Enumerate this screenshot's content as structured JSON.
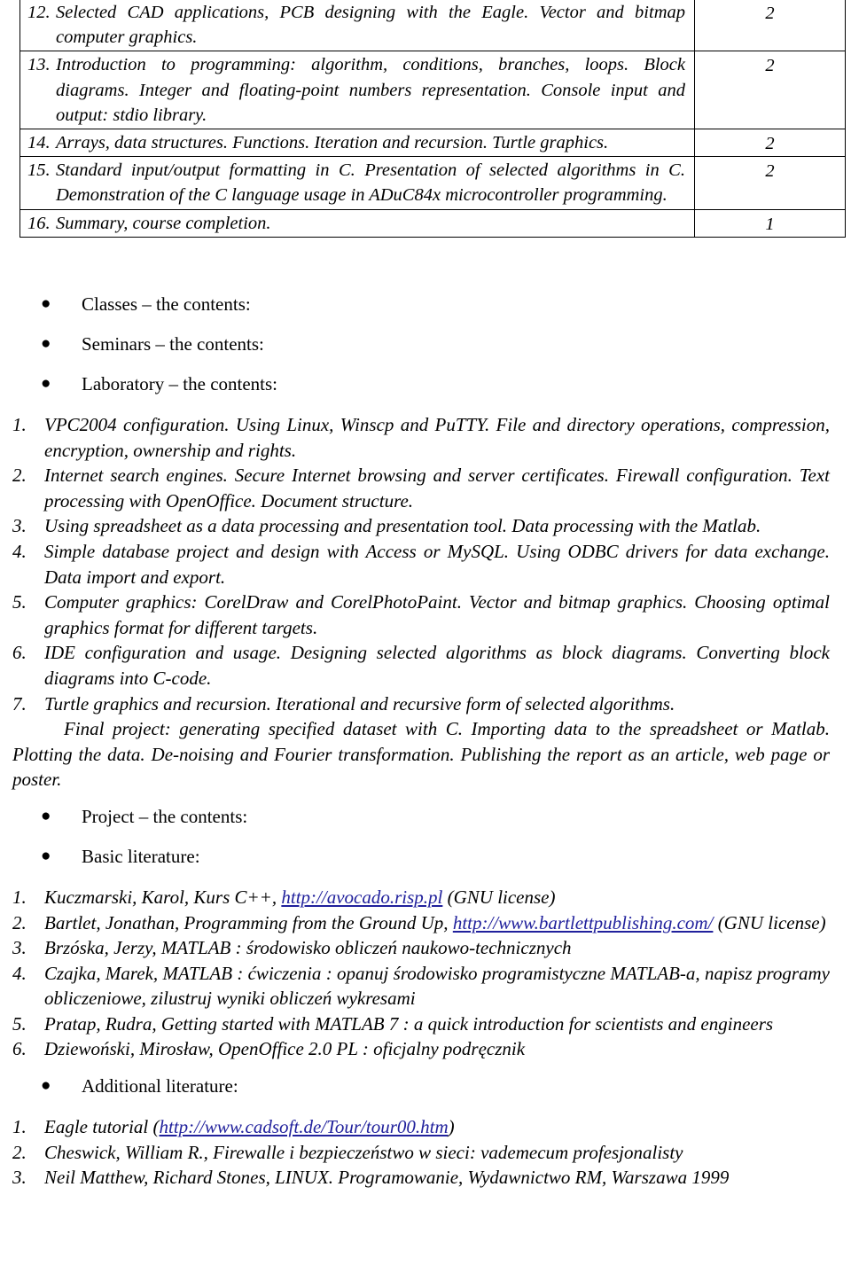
{
  "syllabus_table": {
    "rows": [
      {
        "num": "12.",
        "text": "Selected CAD applications, PCB designing with the Eagle. Vector and bitmap computer graphics.",
        "hours": "2"
      },
      {
        "num": "13.",
        "text": "Introduction to programming: algorithm, conditions, branches, loops. Block diagrams. Integer and floating-point numbers representation. Console input and output: stdio library.",
        "hours": "2"
      },
      {
        "num": "14.",
        "text": "Arrays, data structures. Functions. Iteration and recursion. Turtle graphics.",
        "hours": "2"
      },
      {
        "num": "15.",
        "text": "Standard input/output formatting in C. Presentation of selected algorithms in C. Demonstration of the C language usage in ADuC84x microcontroller programming.",
        "hours": "2"
      },
      {
        "num": "16.",
        "text": "Summary, course completion.",
        "hours": "1"
      }
    ]
  },
  "section_headings": {
    "classes": "Classes – the contents:",
    "seminars": "Seminars – the contents:",
    "laboratory": "Laboratory – the contents:",
    "project": "Project – the contents:",
    "basic_literature": "Basic literature:",
    "additional_literature": "Additional literature:",
    "bullet_glyph": "●"
  },
  "laboratory_items": [
    {
      "num": "1.",
      "text": "VPC2004 configuration. Using Linux, Winscp and PuTTY. File and directory operations, compression, encryption, ownership and rights."
    },
    {
      "num": "2.",
      "text": "Internet search engines. Secure Internet browsing and server certificates. Firewall configuration.  Text processing with OpenOffice. Document structure."
    },
    {
      "num": "3.",
      "text": "Using spreadsheet as a data processing and presentation tool. Data processing with the Matlab."
    },
    {
      "num": "4.",
      "text": "Simple database project and design with Access or MySQL. Using ODBC drivers for data exchange. Data import and export."
    },
    {
      "num": "5.",
      "text": "Computer graphics: CorelDraw and CorelPhotoPaint. Vector and bitmap graphics. Choosing optimal graphics format for different targets."
    },
    {
      "num": "6.",
      "text": "IDE configuration and usage. Designing selected algorithms as block diagrams. Converting block diagrams into C-code."
    },
    {
      "num": "7.",
      "text": "Turtle graphics and recursion. Iterational and recursive form of selected algorithms."
    }
  ],
  "final_project_paragraph": "Final project: generating specified dataset with C. Importing data to the spreadsheet or Matlab. Plotting the data. De-noising and Fourier transformation. Publishing the report as an article, web page or poster.",
  "basic_literature_items": [
    {
      "num": "1.",
      "before": "Kuczmarski, Karol, Kurs C++, ",
      "link": "http://avocado.risp.pl",
      "after": " (GNU license)"
    },
    {
      "num": "2.",
      "before": "Bartlet, Jonathan, Programming from the Ground Up, ",
      "link": "http://www.bartlettpublishing.com/",
      "after": " (GNU license)"
    },
    {
      "num": "3.",
      "before": "Brzóska, Jerzy, MATLAB : środowisko obliczeń naukowo-technicznych",
      "link": "",
      "after": ""
    },
    {
      "num": "4.",
      "before": "Czajka, Marek, MATLAB : ćwiczenia : opanuj środowisko programistyczne MATLAB-a, napisz programy obliczeniowe, zilustruj wyniki obliczeń wykresami",
      "link": "",
      "after": ""
    },
    {
      "num": "5.",
      "before": "Pratap, Rudra, Getting started with MATLAB 7 : a quick introduction for scientists and engineers",
      "link": "",
      "after": ""
    },
    {
      "num": "6.",
      "before": "Dziewoński, Mirosław, OpenOffice 2.0 PL : oficjalny podręcznik",
      "link": "",
      "after": ""
    }
  ],
  "additional_literature_items": [
    {
      "num": "1.",
      "before": "Eagle tutorial (",
      "link": "http://www.cadsoft.de/Tour/tour00.htm",
      "after": ")"
    },
    {
      "num": "2.",
      "before": "Cheswick, William R., Firewalle i bezpieczeństwo w sieci: vademecum profesjonalisty",
      "link": "",
      "after": ""
    },
    {
      "num": "3.",
      "before": "Neil Matthew, Richard Stones, LINUX. Programowanie, Wydawnictwo RM, Warszawa 1999",
      "link": "",
      "after": ""
    }
  ],
  "colors": {
    "link": "#21219c",
    "text": "#000000",
    "border": "#000000"
  }
}
